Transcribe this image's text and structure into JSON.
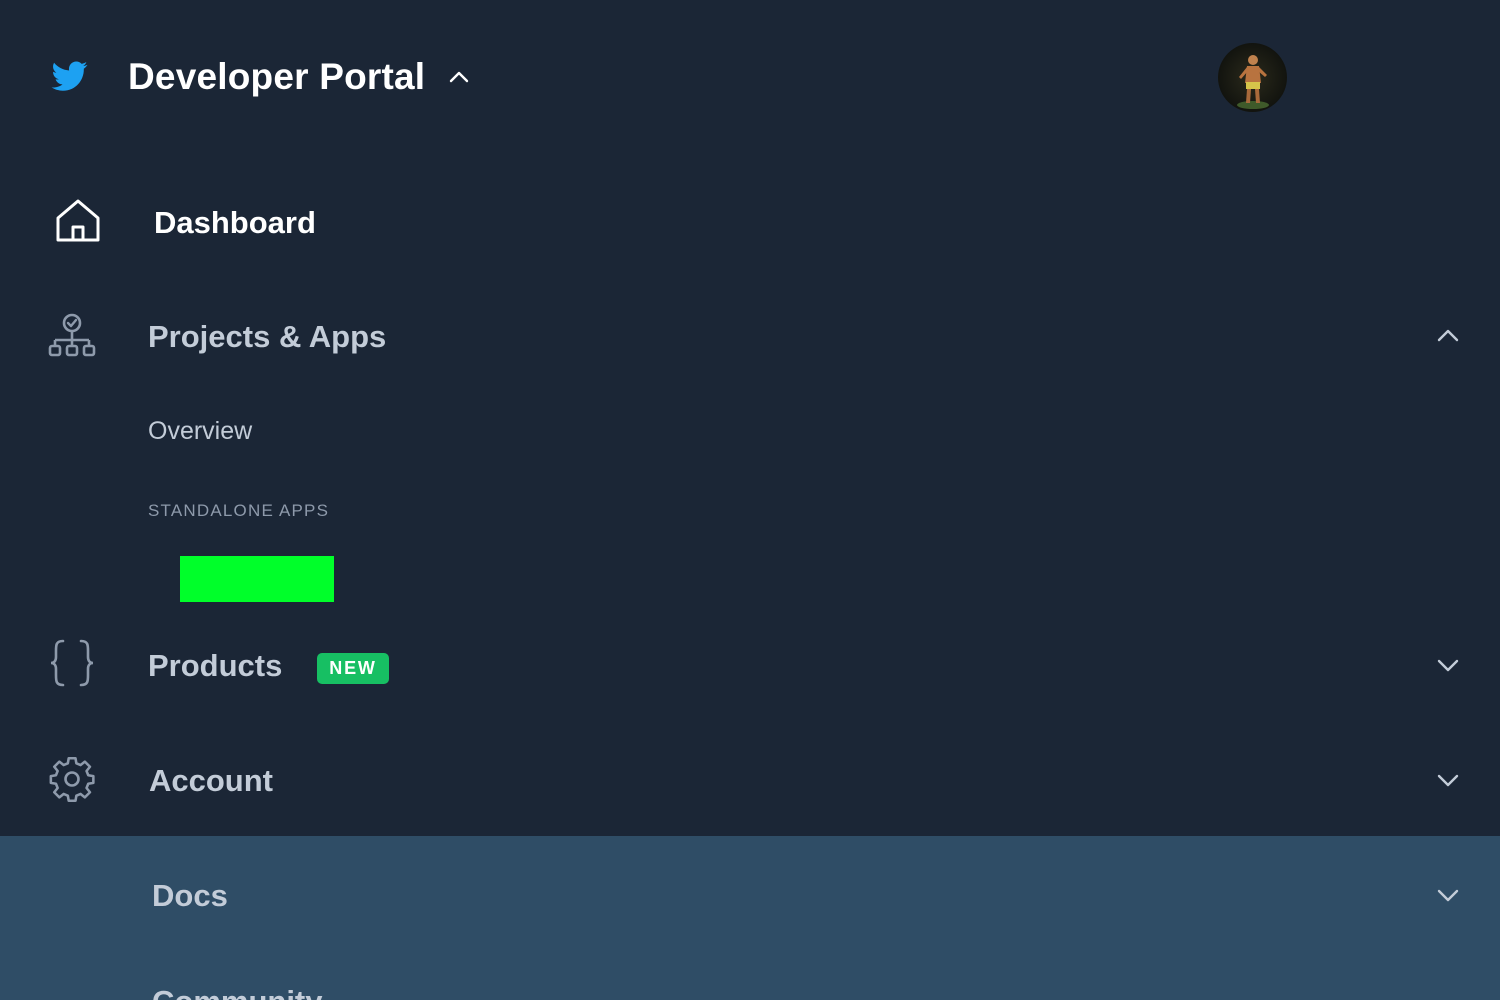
{
  "header": {
    "logo_icon": "twitter-bird-icon",
    "title": "Developer Portal",
    "title_chevron_icon": "chevron-up-icon",
    "avatar_alt": "user-avatar"
  },
  "nav": {
    "dashboard": {
      "label": "Dashboard",
      "icon": "home-icon"
    },
    "projects": {
      "label": "Projects & Apps",
      "icon": "org-chart-icon",
      "chevron": "chevron-up-icon",
      "expanded": true,
      "overview_label": "Overview",
      "section_label": "STANDALONE APPS",
      "standalone_apps_redacted": true
    },
    "products": {
      "label": "Products",
      "icon": "curly-braces-icon",
      "badge": "NEW",
      "chevron": "chevron-down-icon"
    },
    "account": {
      "label": "Account",
      "icon": "gear-icon",
      "chevron": "chevron-down-icon"
    },
    "docs": {
      "label": "Docs",
      "chevron": "chevron-down-icon"
    },
    "next_partial_label": "Community"
  },
  "colors": {
    "background": "#1b2636",
    "docs_band": "#2f4d66",
    "brand_blue": "#1da1f2",
    "badge_green": "#17bf63",
    "redaction": "#00ff2a"
  }
}
